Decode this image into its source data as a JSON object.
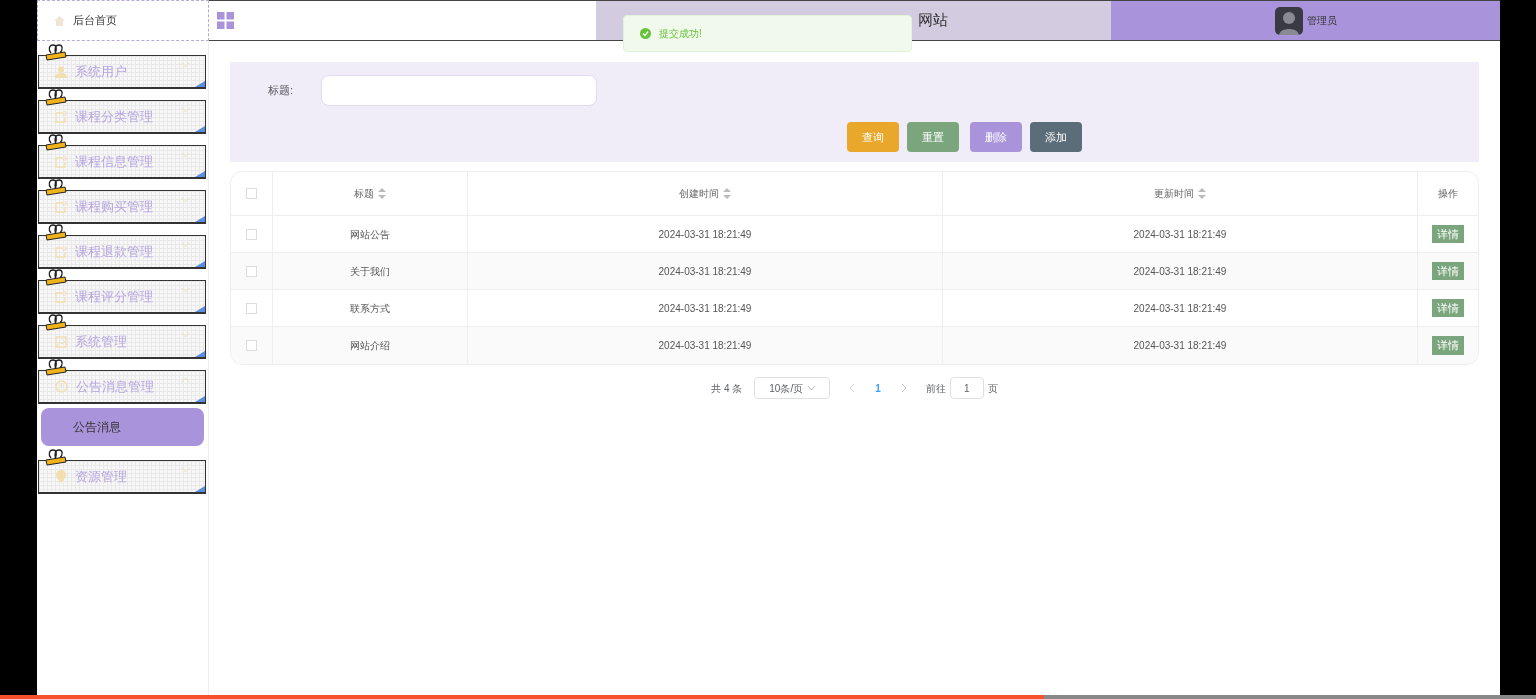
{
  "topbar": {
    "home": "后台首页",
    "title": "网站",
    "user": "管理员"
  },
  "toast": {
    "text": "提交成功!"
  },
  "sidebar": {
    "items": [
      {
        "label": "系统用户",
        "expanded": false
      },
      {
        "label": "课程分类管理",
        "expanded": false
      },
      {
        "label": "课程信息管理",
        "expanded": false
      },
      {
        "label": "课程购买管理",
        "expanded": false
      },
      {
        "label": "课程退款管理",
        "expanded": false
      },
      {
        "label": "课程评分管理",
        "expanded": false
      },
      {
        "label": "系统管理",
        "expanded": false
      },
      {
        "label": "公告消息管理",
        "expanded": true,
        "children": [
          {
            "label": "公告消息",
            "selected": true
          }
        ]
      },
      {
        "label": "资源管理",
        "expanded": false
      }
    ]
  },
  "search": {
    "label": "标题:",
    "buttons": [
      {
        "label": "查询",
        "color": "#e9a82c"
      },
      {
        "label": "重置",
        "color": "#7ba57c"
      },
      {
        "label": "删除",
        "color": "#a994db"
      },
      {
        "label": "添加",
        "color": "#5b6d78"
      }
    ]
  },
  "table": {
    "all_checked": false,
    "columns": [
      {
        "label": "标题",
        "sortable": true
      },
      {
        "label": "创建时间",
        "sortable": true
      },
      {
        "label": "更新时间",
        "sortable": true
      },
      {
        "label": "操作",
        "sortable": false
      }
    ],
    "rows": [
      {
        "checked": false,
        "cells": [
          "网站公告",
          "2024-03-31 18:21:49",
          "2024-03-31 18:21:49"
        ],
        "action": "详情"
      },
      {
        "checked": false,
        "cells": [
          "关于我们",
          "2024-03-31 18:21:49",
          "2024-03-31 18:21:49"
        ],
        "action": "详情"
      },
      {
        "checked": false,
        "cells": [
          "联系方式",
          "2024-03-31 18:21:49",
          "2024-03-31 18:21:49"
        ],
        "action": "详情"
      },
      {
        "checked": false,
        "cells": [
          "网站介绍",
          "2024-03-31 18:21:49",
          "2024-03-31 18:21:49"
        ],
        "action": "详情"
      }
    ]
  },
  "pagination": {
    "total": "共 4 条",
    "page_size": "10条/页",
    "pages": [
      {
        "label": "1",
        "selected": true
      }
    ],
    "goto": "前往",
    "goto_value": "1",
    "page_unit": "页"
  },
  "player": {
    "level": 0.68
  }
}
